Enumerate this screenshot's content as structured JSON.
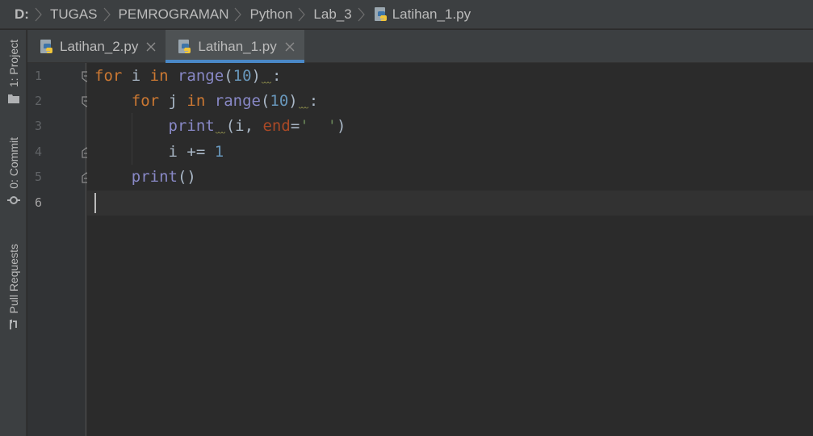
{
  "breadcrumb": {
    "drive": "D:",
    "parts": [
      "TUGAS",
      "PEMROGRAMAN",
      "Python",
      "Lab_3"
    ],
    "file": "Latihan_1.py",
    "file_icon": "python-file-icon"
  },
  "left_strip": {
    "project_label": "1: Project",
    "commit_label": "0: Commit",
    "pull_requests_label": "Pull Requests"
  },
  "tabs": [
    {
      "label": "Latihan_2.py",
      "active": false
    },
    {
      "label": "Latihan_1.py",
      "active": true
    }
  ],
  "editor": {
    "line_numbers": [
      "1",
      "2",
      "3",
      "4",
      "5",
      "6"
    ],
    "current_line": "6",
    "code": {
      "l1": {
        "kw_for": "for",
        "var_i": " i ",
        "kw_in": "in",
        "fn": " range",
        "paren_open": "(",
        "num": "10",
        "paren_close": ")",
        "colon": ":"
      },
      "l2": {
        "kw_for": "for",
        "var_j": " j ",
        "kw_in": "in",
        "fn": " range",
        "paren_open": "(",
        "num": "10",
        "paren_close": ")",
        "colon": ":"
      },
      "l3": {
        "fn": "print",
        "args_open": "(i, ",
        "param": "end",
        "eq": "=",
        "str": "'  '",
        "paren_close": ")"
      },
      "l4": {
        "expr": "i += ",
        "num": "1"
      },
      "l5": {
        "fn": "print",
        "parens": "()"
      }
    }
  },
  "colors": {
    "keyword": "#cc7832",
    "builtin": "#8888c6",
    "number": "#6897bb",
    "string": "#6a8759",
    "param": "#aa4926",
    "active_tab_underline": "#4a88c7"
  }
}
